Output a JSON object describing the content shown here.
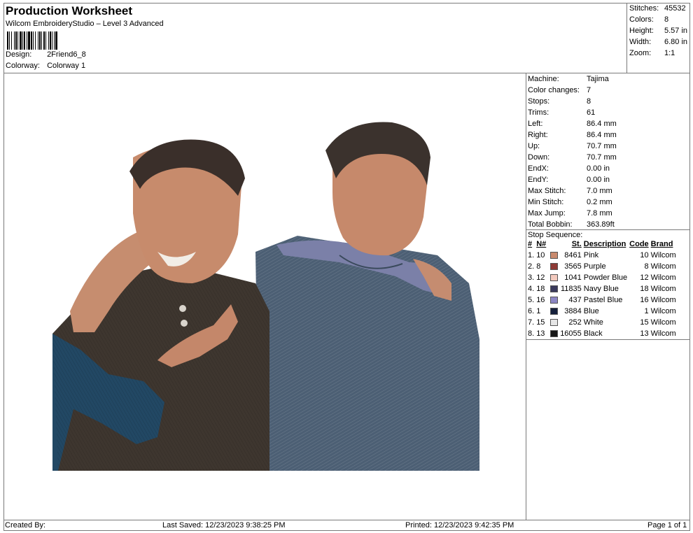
{
  "header": {
    "title": "Production Worksheet",
    "subtitle": "Wilcom EmbroideryStudio – Level 3 Advanced",
    "design_label": "Design:",
    "design_value": "2Friend6_8",
    "colorway_label": "Colorway:",
    "colorway_value": "Colorway 1"
  },
  "stats": {
    "stitches_label": "Stitches:",
    "stitches": "45532",
    "colors_label": "Colors:",
    "colors": "8",
    "height_label": "Height:",
    "height": "5.57 in",
    "width_label": "Width:",
    "width": "6.80 in",
    "zoom_label": "Zoom:",
    "zoom": "1:1"
  },
  "machine": {
    "machine_label": "Machine:",
    "machine": "Tajima",
    "color_changes_label": "Color changes:",
    "color_changes": "7",
    "stops_label": "Stops:",
    "stops": "8",
    "trims_label": "Trims:",
    "trims": "61",
    "left_label": "Left:",
    "left": "86.4 mm",
    "right_label": "Right:",
    "right": "86.4 mm",
    "up_label": "Up:",
    "up": "70.7 mm",
    "down_label": "Down:",
    "down": "70.7 mm",
    "endx_label": "EndX:",
    "endx": "0.00 in",
    "endy_label": "EndY:",
    "endy": "0.00 in",
    "max_stitch_label": "Max Stitch:",
    "max_stitch": "7.0 mm",
    "min_stitch_label": "Min Stitch:",
    "min_stitch": "0.2 mm",
    "max_jump_label": "Max Jump:",
    "max_jump": "7.8 mm",
    "total_bobbin_label": "Total Bobbin:",
    "total_bobbin": "363.89ft"
  },
  "stop_sequence": {
    "title": "Stop Sequence:",
    "columns": {
      "num": "#",
      "needle": "N#",
      "stitches": "St.",
      "description": "Description",
      "code": "Code",
      "brand": "Brand"
    },
    "rows": [
      {
        "num": "1.",
        "needle": "10",
        "color": "#c98a6e",
        "stitches": "8461",
        "description": "Pink",
        "code": "10",
        "brand": "Wilcom"
      },
      {
        "num": "2.",
        "needle": "8",
        "color": "#8e3a36",
        "stitches": "3565",
        "description": "Purple",
        "code": "8",
        "brand": "Wilcom"
      },
      {
        "num": "3.",
        "needle": "12",
        "color": "#f2c9bd",
        "stitches": "1041",
        "description": "Powder Blue",
        "code": "12",
        "brand": "Wilcom"
      },
      {
        "num": "4.",
        "needle": "18",
        "color": "#3a3a5c",
        "stitches": "11835",
        "description": "Navy Blue",
        "code": "18",
        "brand": "Wilcom"
      },
      {
        "num": "5.",
        "needle": "16",
        "color": "#8c86c4",
        "stitches": "437",
        "description": "Pastel Blue",
        "code": "16",
        "brand": "Wilcom"
      },
      {
        "num": "6.",
        "needle": "1",
        "color": "#15203c",
        "stitches": "3884",
        "description": "Blue",
        "code": "1",
        "brand": "Wilcom"
      },
      {
        "num": "7.",
        "needle": "15",
        "color": "#e6e6e6",
        "stitches": "252",
        "description": "White",
        "code": "15",
        "brand": "Wilcom"
      },
      {
        "num": "8.",
        "needle": "13",
        "color": "#161616",
        "stitches": "16055",
        "description": "Black",
        "code": "13",
        "brand": "Wilcom"
      }
    ]
  },
  "footer": {
    "created_by": "Created By:",
    "last_saved": "Last Saved: 12/23/2023 9:38:25 PM",
    "printed": "Printed: 12/23/2023 9:42:35 PM",
    "page": "Page 1 of 1"
  }
}
